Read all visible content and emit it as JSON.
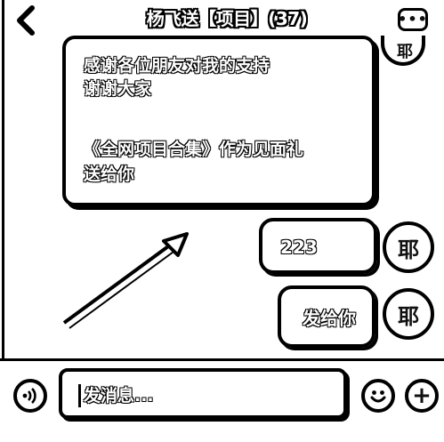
{
  "header": {
    "back_icon": "chevron-left-icon",
    "title": "杨飞送【项目】(37)",
    "more_icon": "more-dots-icon",
    "more_label": "•••"
  },
  "messages": {
    "incoming": {
      "lines": [
        "感谢各位朋友对我的支持",
        "谢谢大家",
        "《全网项目合集》作为见面礼",
        "送给你"
      ]
    },
    "outgoing": [
      {
        "text": "223"
      },
      {
        "text": "发给你"
      }
    ],
    "avatar_glyph": "耶"
  },
  "input_bar": {
    "voice_icon": "voice-icon",
    "placeholder": "发消息...",
    "emoji_icon": "emoji-icon",
    "plus_icon": "plus-icon",
    "plus_label": "+"
  },
  "colors": {
    "ink": "#000000",
    "background": "#ffffff"
  }
}
